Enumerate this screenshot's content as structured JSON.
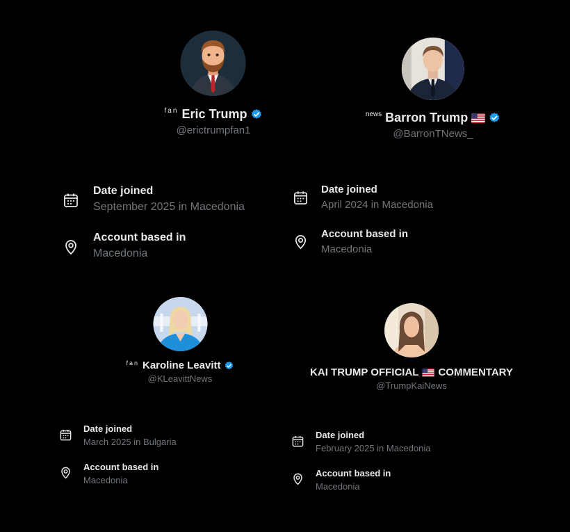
{
  "profiles": [
    {
      "prefix": "fan",
      "name": "Eric Trump",
      "handle": "@erictrumpfan1",
      "verified": true,
      "flag": false,
      "date_label": "Date joined",
      "date_value": "September 2025 in Macedonia",
      "location_label": "Account based in",
      "location_value": "Macedonia"
    },
    {
      "prefix": "news",
      "name": "Barron Trump",
      "handle": "@BarronTNews_",
      "verified": true,
      "flag": true,
      "date_label": "Date joined",
      "date_value": "April 2024 in Macedonia",
      "location_label": "Account based in",
      "location_value": "Macedonia"
    },
    {
      "prefix": "fan",
      "name": "Karoline Leavitt",
      "handle": "@KLeavittNews",
      "verified": true,
      "flag": false,
      "date_label": "Date joined",
      "date_value": "March 2025 in Bulgaria",
      "location_label": "Account based in",
      "location_value": "Macedonia"
    },
    {
      "prefix": "",
      "name_part1": "KAI TRUMP OFFICIAL",
      "name_part2": "COMMENTARY",
      "handle": "@TrumpKaiNews",
      "verified": false,
      "flag": true,
      "date_label": "Date joined",
      "date_value": "February 2025 in Macedonia",
      "location_label": "Account based in",
      "location_value": "Macedonia"
    }
  ],
  "colors": {
    "background": "#000000",
    "text": "#e7e9ea",
    "muted": "#71767b",
    "verified": "#1d9bf0"
  },
  "icons": [
    "calendar-icon",
    "location-pin-icon",
    "verified-badge-icon",
    "us-flag-icon"
  ]
}
